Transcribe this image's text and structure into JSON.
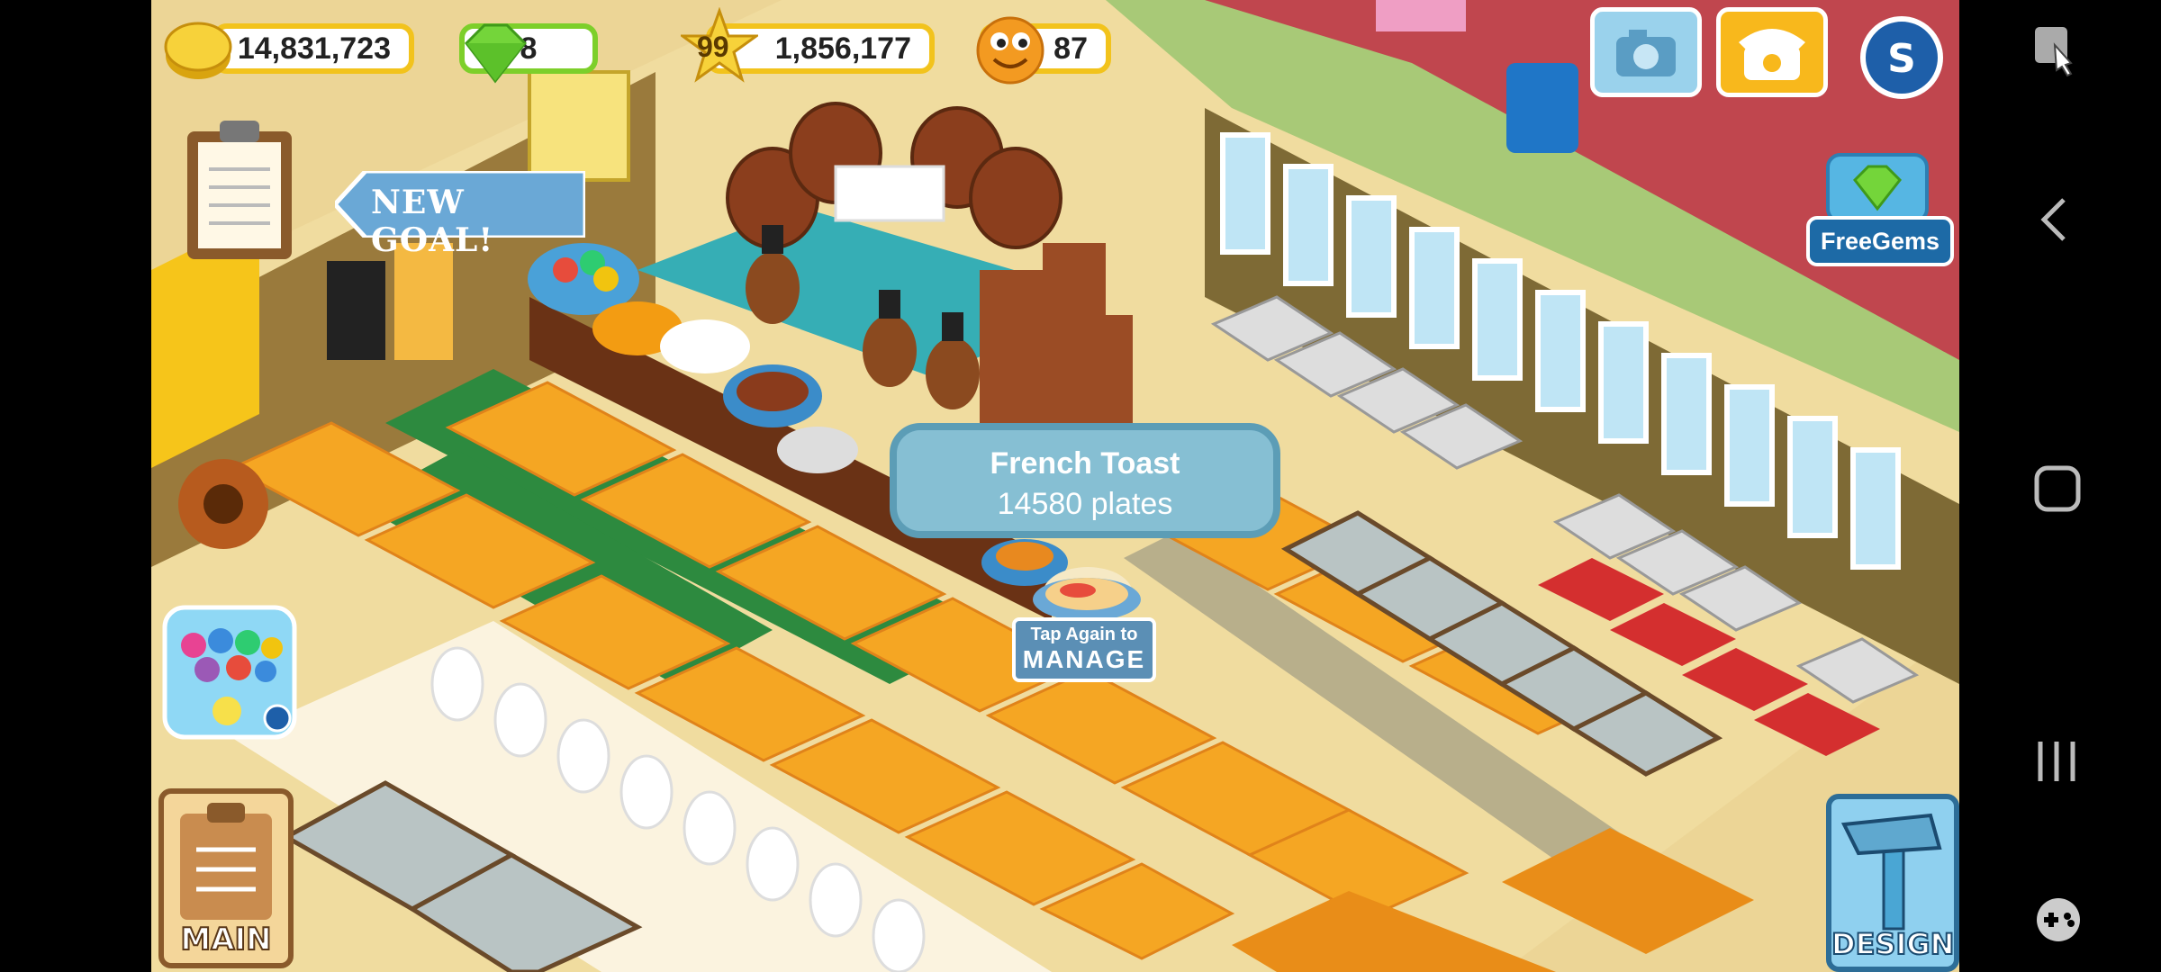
{
  "hud": {
    "coins": "14,831,723",
    "gems": "8",
    "level": "99",
    "xp": "1,856,177",
    "friends": "87"
  },
  "goal_banner": {
    "label": "NEW GOAL!"
  },
  "tooltip": {
    "item_name": "French Toast",
    "plates": "14580 plates"
  },
  "manage_sign": {
    "line1": "Tap Again to",
    "line2": "MANAGE"
  },
  "buttons": {
    "main": "MAIN",
    "design": "DESIGN",
    "free_gems": "FreeGems"
  },
  "colors": {
    "coin_gold": "#f2c31c",
    "gem_green": "#7dcf2a",
    "bubble_blue": "#86bfd3",
    "table_orange": "#f5a623"
  },
  "icons": [
    "coin-icon",
    "gem-icon",
    "star-icon",
    "friend-face-icon",
    "camera-icon",
    "telephone-icon",
    "game-s-icon",
    "clipboard-icon",
    "bubble-game-icon",
    "hammer-icon",
    "free-gem-tv-icon"
  ],
  "nav": [
    "screenshot-icon",
    "back-icon",
    "home-icon",
    "recents-icon",
    "game-tools-icon"
  ]
}
